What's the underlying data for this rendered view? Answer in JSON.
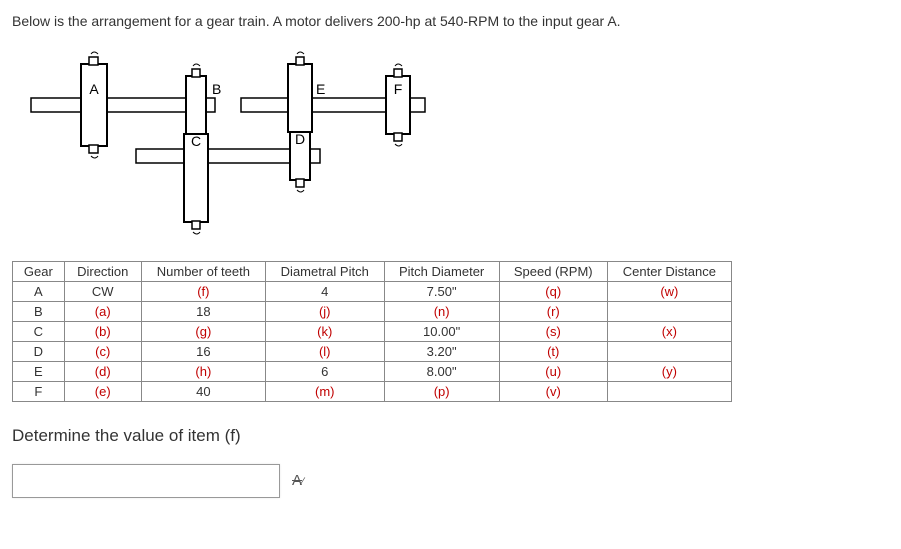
{
  "problem": "Below is the arrangement for a gear train.  A motor delivers 200-hp at 540-RPM to the input gear A.",
  "gears_labels": {
    "a": "A",
    "b": "B",
    "c": "C",
    "d": "D",
    "e": "E",
    "f": "F"
  },
  "table": {
    "headers": {
      "gear": "Gear",
      "direction": "Direction",
      "teeth": "Number of teeth",
      "dp": "Diametral Pitch",
      "pd": "Pitch Diameter",
      "speed": "Speed (RPM)",
      "cd": "Center Distance"
    },
    "rows": {
      "A": {
        "gear": "A",
        "direction": "CW",
        "teeth": "(f)",
        "dp": "4",
        "pd": "7.50\"",
        "speed": "(q)",
        "cd": "(w)"
      },
      "B": {
        "gear": "B",
        "direction": "(a)",
        "teeth": "18",
        "dp": "(j)",
        "pd": "(n)",
        "speed": "(r)",
        "cd": ""
      },
      "C": {
        "gear": "C",
        "direction": "(b)",
        "teeth": "(g)",
        "dp": "(k)",
        "pd": "10.00\"",
        "speed": "(s)",
        "cd": "(x)"
      },
      "D": {
        "gear": "D",
        "direction": "(c)",
        "teeth": "16",
        "dp": "(l)",
        "pd": "3.20\"",
        "speed": "(t)",
        "cd": ""
      },
      "E": {
        "gear": "E",
        "direction": "(d)",
        "teeth": "(h)",
        "dp": "6",
        "pd": "8.00\"",
        "speed": "(u)",
        "cd": "(y)"
      },
      "F": {
        "gear": "F",
        "direction": "(e)",
        "teeth": "40",
        "dp": "(m)",
        "pd": "(p)",
        "speed": "(v)",
        "cd": ""
      }
    }
  },
  "question": "Determine the value of item (f)",
  "eq_icon": "A✓"
}
